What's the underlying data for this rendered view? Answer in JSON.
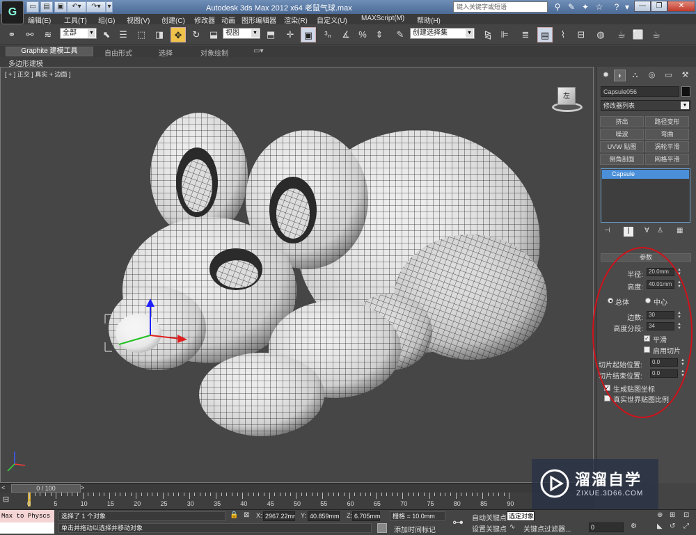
{
  "window": {
    "title": "Autodesk 3ds Max  2012 x64     老鼠气球.max",
    "search_placeholder": "键入关键字或短语"
  },
  "menu": [
    "编辑(E)",
    "工具(T)",
    "组(G)",
    "视图(V)",
    "创建(C)",
    "修改器",
    "动画",
    "图形编辑器",
    "渲染(R)",
    "自定义(U)",
    "MAXScript(M)",
    "帮助(H)"
  ],
  "toolbar": {
    "selection_filter": "全部",
    "ref_coord": "视图",
    "named_sel_set": "创建选择集"
  },
  "ribbon": {
    "tabs": [
      "Graphite 建模工具",
      "自由形式",
      "选择",
      "对象绘制"
    ],
    "sub_label": "多边形建模"
  },
  "viewport": {
    "label": "[ + ] 正交 ] 真实 + 边面 ]",
    "cube_label": "左"
  },
  "panel": {
    "object_name": "Capsule056",
    "modifier_list": "修改器列表",
    "modifier_buttons": [
      "挤出",
      "路径变形",
      "噪波",
      "弯曲",
      "UVW 贴图",
      "涡轮平滑",
      "倒角剖面",
      "网格平滑"
    ],
    "stack_item": "Capsule",
    "params_title": "参数",
    "radius_label": "半径:",
    "radius_value": "20.0mm",
    "height_label": "高度:",
    "height_value": "40.01mm",
    "radio_overall": "总体",
    "radio_center": "中心",
    "sides_label": "边数:",
    "sides_value": "30",
    "height_segs_label": "高度分段:",
    "height_segs_value": "34",
    "smooth_label": "平滑",
    "slice_on_label": "启用切片",
    "slice_from_label": "切片起始位置:",
    "slice_from_value": "0.0",
    "slice_to_label": "切片结束位置:",
    "slice_to_value": "0.0",
    "gen_map_label": "生成贴图坐标",
    "real_world_label": "真实世界贴图比例"
  },
  "timeline": {
    "slider": "0 / 100",
    "ticks": [
      "0",
      "5",
      "10",
      "15",
      "20",
      "25",
      "30",
      "35",
      "40",
      "45",
      "50",
      "55",
      "60",
      "65",
      "70",
      "75",
      "80",
      "85",
      "90"
    ]
  },
  "status": {
    "listener": "Max to Physcs (",
    "selected": "选择了 1 个对象",
    "prompt": "单击并拖动以选择并移动对象",
    "x_label": "X:",
    "x_value": "2967.22mr",
    "y_label": "Y:",
    "y_value": "40.859mm",
    "z_label": "Z:",
    "z_value": "6.705mm",
    "grid": "栅格 = 10.0mm",
    "add_time_tag": "添加时间标记",
    "auto_key": "自动关键点",
    "set_key": "设置关键点",
    "selected_obj": "选定对象",
    "key_filters": "关键点过滤器...",
    "frame": "0"
  },
  "watermark": {
    "brand": "溜溜自学",
    "url": "ZIXUE.3D66.COM"
  },
  "colors": {
    "accent_yellow": "#f0c24a",
    "selection_blue": "#4a8fd8",
    "annotation_red": "#d0121b"
  }
}
